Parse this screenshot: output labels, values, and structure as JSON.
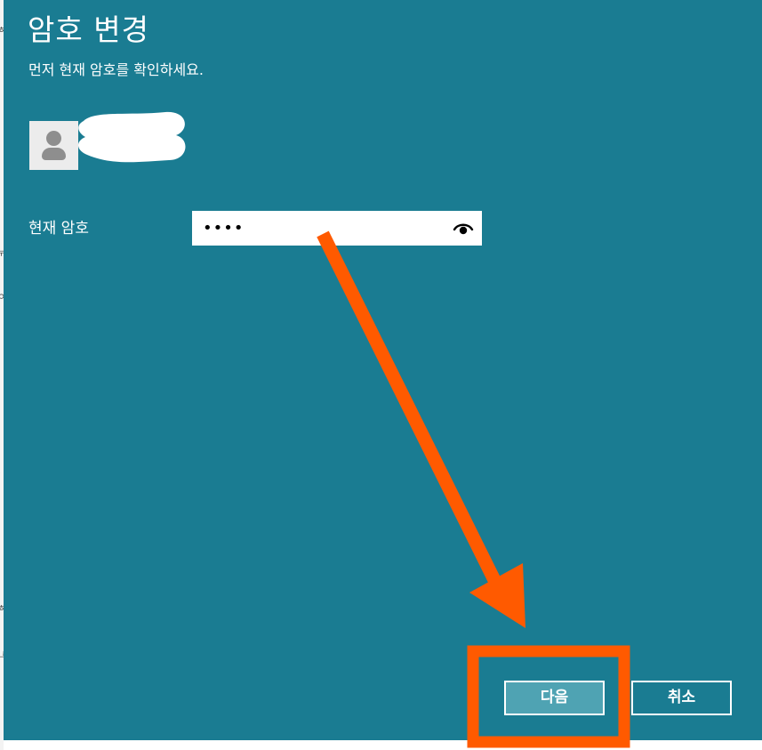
{
  "dialog": {
    "title": "암호 변경",
    "subtitle": "먼저 현재 암호를 확인하세요."
  },
  "account": {
    "avatar_icon": "user-placeholder-icon"
  },
  "form": {
    "current_password_label": "현재 암호",
    "current_password_value": "••••",
    "reveal_icon": "eye-reveal-icon"
  },
  "buttons": {
    "next_label": "다음",
    "cancel_label": "취소"
  },
  "colors": {
    "dialog_background": "#1a7c92",
    "primary_button": "#4fa3b3",
    "annotation_orange": "#ff5a00"
  },
  "underlay": {
    "glyphs": [
      "ㅎ",
      "두",
      "ㅇ",
      ")",
      "ㅎ",
      "그"
    ]
  }
}
